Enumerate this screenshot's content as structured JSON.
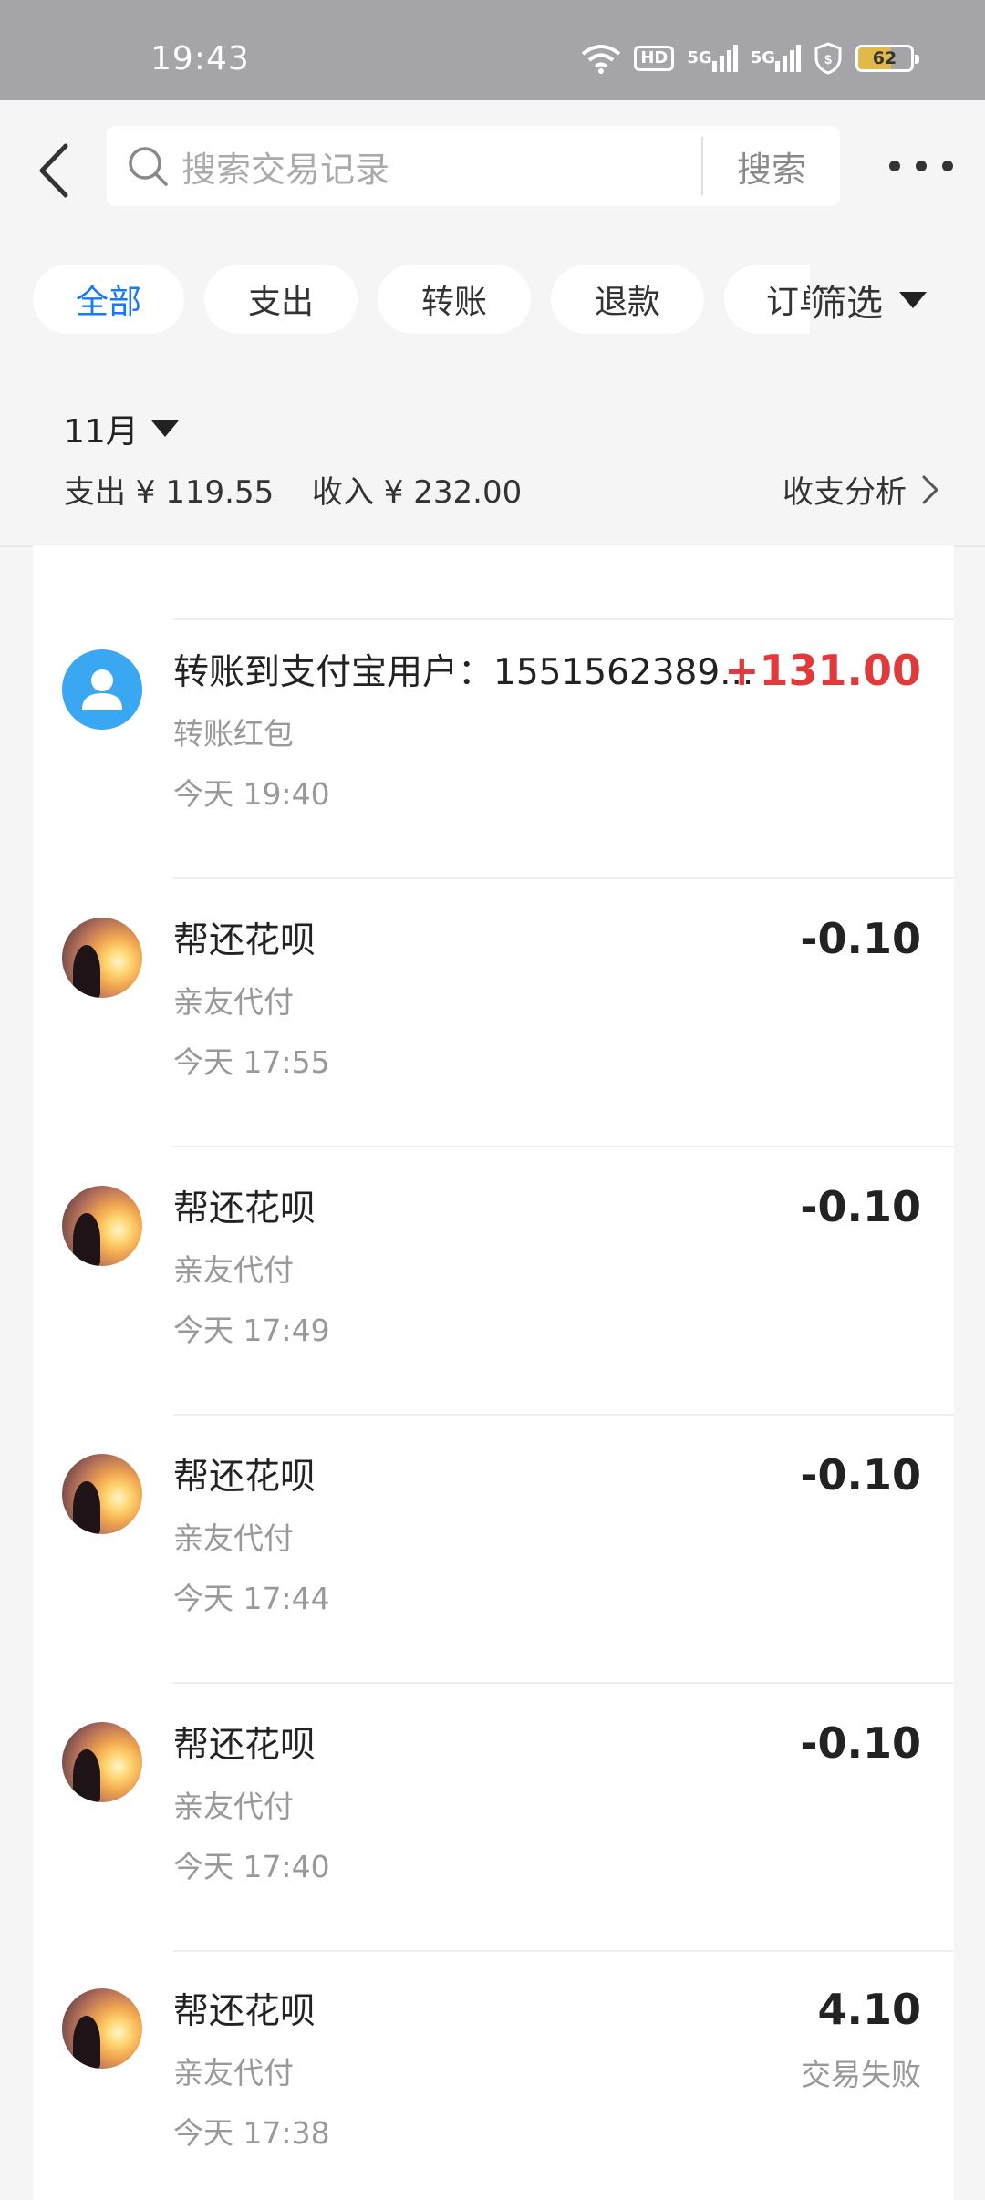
{
  "status_bar": {
    "time": "19:43",
    "network_badge": "HD",
    "signal_1": "5G",
    "signal_2": "5G",
    "battery": "62"
  },
  "search": {
    "placeholder": "搜索交易记录",
    "button": "搜索"
  },
  "filters": {
    "chips": [
      "全部",
      "支出",
      "转账",
      "退款",
      "订单"
    ],
    "active": "全部",
    "filter_label": "筛选"
  },
  "month": {
    "label": "11月",
    "expense": "支出 ¥ 119.55",
    "income": "收入 ¥ 232.00",
    "analysis": "收支分析"
  },
  "transactions": [
    {
      "title": "转账到支付宝用户：1551562389...",
      "subtitle": "转账红包",
      "time": "今天 19:40",
      "amount": "+131.00",
      "status": ""
    },
    {
      "title": "帮还花呗",
      "subtitle": "亲友代付",
      "time": "今天 17:55",
      "amount": "-0.10",
      "status": ""
    },
    {
      "title": "帮还花呗",
      "subtitle": "亲友代付",
      "time": "今天 17:49",
      "amount": "-0.10",
      "status": ""
    },
    {
      "title": "帮还花呗",
      "subtitle": "亲友代付",
      "time": "今天 17:44",
      "amount": "-0.10",
      "status": ""
    },
    {
      "title": "帮还花呗",
      "subtitle": "亲友代付",
      "time": "今天 17:40",
      "amount": "-0.10",
      "status": ""
    },
    {
      "title": "帮还花呗",
      "subtitle": "亲友代付",
      "time": "今天 17:38",
      "amount": "4.10",
      "status": "交易失败"
    }
  ],
  "colors": {
    "accent": "#1677ff",
    "income": "#e03a3a",
    "status_bar": "#a5a4a8"
  }
}
